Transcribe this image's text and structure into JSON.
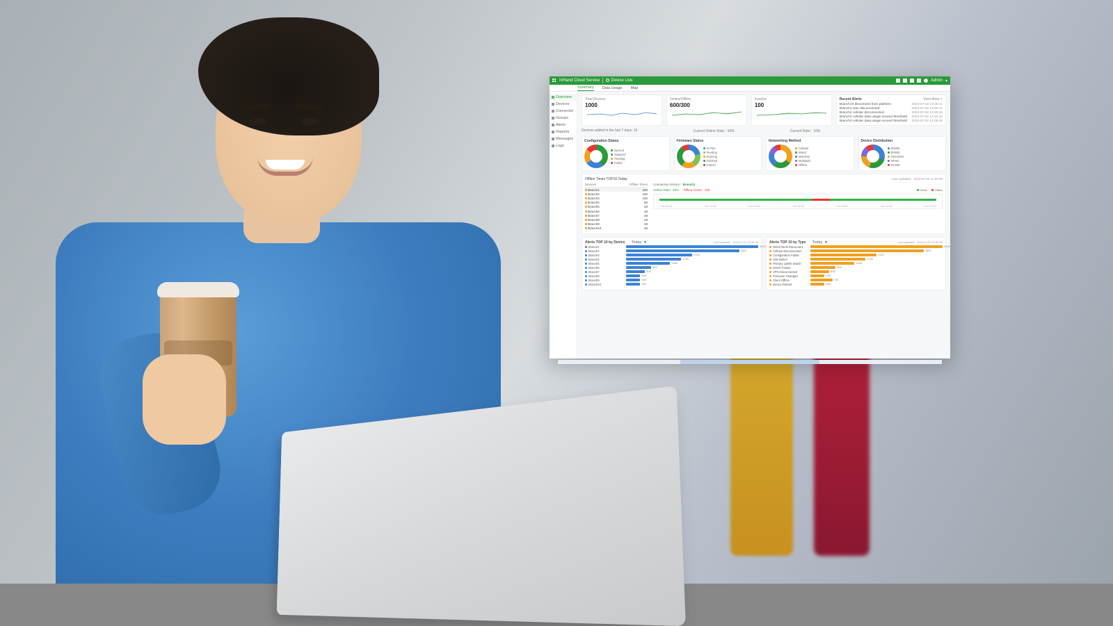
{
  "topbar": {
    "brand": "InHand Cloud Service",
    "section": "Device Live",
    "user": "Admin"
  },
  "tabs": [
    "Summary",
    "Data Usage",
    "Map"
  ],
  "sidebar": [
    {
      "label": "Overview",
      "active": true
    },
    {
      "label": "Devices"
    },
    {
      "label": "Connector"
    },
    {
      "label": "Groups"
    },
    {
      "label": "Alerts"
    },
    {
      "label": "Reports"
    },
    {
      "label": "Messages"
    },
    {
      "label": "Logs"
    }
  ],
  "kpi": [
    {
      "label": "Total Devices",
      "value": "1000"
    },
    {
      "label": "Online/Offline",
      "value": "600/300"
    },
    {
      "label": "Inactive",
      "value": "100"
    }
  ],
  "kpiAlerts": {
    "title": "Recent Alerts",
    "more": "View More >",
    "rows": [
      {
        "t": "Branch10 disconnect from platform",
        "d": "2023-07-02 13:45:11"
      },
      {
        "t": "Branch1 wan disconnected",
        "d": "2023-07-02 13:40:14"
      },
      {
        "t": "Branch2 cellular disconnected",
        "d": "2023-07-02 13:25:40"
      },
      {
        "t": "Branch2 cellular data usage exceed threshold",
        "d": "2023-07-02 12:10:22"
      },
      {
        "t": "Branch3 cellular data usage exceed threshold",
        "d": "2023-07-02 12:00:00"
      }
    ]
  },
  "below": {
    "a": "Devices added in the last 7 days: 10",
    "b": "Current Online Rate：60%",
    "c": "Current Rate：10%"
  },
  "donuts": [
    {
      "title": "Configuration Status",
      "legend": [
        [
          "Synced",
          "#2a9a3a"
        ],
        [
          "Suspend",
          "#3b82d6"
        ],
        [
          "Pending",
          "#f0a020"
        ],
        [
          "Failed",
          "#e33"
        ]
      ]
    },
    {
      "title": "Firmware Status",
      "legend": [
        [
          "In Plan",
          "#3b82d6"
        ],
        [
          "Pending",
          "#7cc250"
        ],
        [
          "Running",
          "#f0a020"
        ],
        [
          "Finished",
          "#2a9a3a"
        ],
        [
          "Cancel",
          "#e33"
        ]
      ]
    },
    {
      "title": "Networking Method",
      "legend": [
        [
          "Cellular",
          "#f0a020"
        ],
        [
          "Wired",
          "#2a9a3a"
        ],
        [
          "Wireless",
          "#3b82d6"
        ],
        [
          "Multipath",
          "#8a63d2"
        ],
        [
          "Offline",
          "#e33"
        ]
      ]
    },
    {
      "title": "Device Distribution",
      "legend": [
        [
          "ER805",
          "#3b82d6"
        ],
        [
          "ER605",
          "#2a9a3a"
        ],
        [
          "ODU2002",
          "#f0a020"
        ],
        [
          "InPAD",
          "#8a63d2"
        ],
        [
          "EC628",
          "#e33"
        ]
      ]
    }
  ],
  "offline": {
    "title": "Offline Times TOP10  Today",
    "updated": "Last Updated：2023-07-02 11:00:00",
    "cols": [
      "Devices",
      "Offline Times"
    ],
    "rows": [
      [
        "Branch1",
        "260"
      ],
      [
        "Branch2",
        "150"
      ],
      [
        "Branch3",
        "100"
      ],
      [
        "Branch4",
        "50"
      ],
      [
        "Branch5",
        "28"
      ],
      [
        "Branch6",
        "28"
      ],
      [
        "Branch7",
        "28"
      ],
      [
        "Branch8",
        "28"
      ],
      [
        "Branch9",
        "28"
      ],
      [
        "Branch10",
        "28"
      ]
    ],
    "history": {
      "title": "Connection History：",
      "dev": "Branch1",
      "online": "Online Rate：60%",
      "offline": "Offline Times：200",
      "ticks": [
        "7-02 00:00",
        "7-02 02:00",
        "7-02 04:00",
        "7-02 06:00",
        "7-02 08:00",
        "7-02 10:00",
        "7-02 12:00"
      ],
      "legend": [
        "Online",
        "Offline"
      ]
    }
  },
  "alertsDev": {
    "title": "Alerts TOP 10 by Device",
    "period": "Today",
    "updated": "Last Updated：2023-07-02 11:00:00",
    "color": "#3b82d6",
    "rows": [
      [
        "Branch1",
        4200
      ],
      [
        "Branch2",
        3600
      ],
      [
        "Branch3",
        2100
      ],
      [
        "Branch4",
        1750
      ],
      [
        "Branch5",
        1400
      ],
      [
        "Branch6",
        800
      ],
      [
        "Branch7",
        600
      ],
      [
        "Branch8",
        450
      ],
      [
        "Branch9",
        450
      ],
      [
        "Branch10",
        450
      ]
    ]
  },
  "alertsType": {
    "title": "Alerts TOP 10 by Type",
    "period": "Today",
    "updated": "Last Updated：2023-07-02 11:00:00",
    "color": "#f0a020",
    "rows": [
      [
        "Wired WAN Disconnect",
        4200
      ],
      [
        "Cellular Disconnected",
        3600
      ],
      [
        "Configuration Failed",
        2100
      ],
      [
        "SIM Switch",
        1750
      ],
      [
        "Primary Uplink Switch",
        1400
      ],
      [
        "DHCP Failure",
        800
      ],
      [
        "VPN Disconnected",
        600
      ],
      [
        "Firmware Changed",
        450
      ],
      [
        "Client Offline",
        700
      ],
      [
        "Device Reboot",
        450
      ]
    ]
  },
  "chart_data": [
    {
      "type": "bar",
      "title": "Alerts TOP 10 by Device",
      "categories": [
        "Branch1",
        "Branch2",
        "Branch3",
        "Branch4",
        "Branch5",
        "Branch6",
        "Branch7",
        "Branch8",
        "Branch9",
        "Branch10"
      ],
      "values": [
        4200,
        3600,
        2100,
        1750,
        1400,
        800,
        600,
        450,
        450,
        450
      ]
    },
    {
      "type": "bar",
      "title": "Alerts TOP 10 by Type",
      "categories": [
        "Wired WAN Disconnect",
        "Cellular Disconnected",
        "Configuration Failed",
        "SIM Switch",
        "Primary Uplink Switch",
        "DHCP Failure",
        "VPN Disconnected",
        "Firmware Changed",
        "Client Offline",
        "Device Reboot"
      ],
      "values": [
        4200,
        3600,
        2100,
        1750,
        1400,
        800,
        600,
        450,
        700,
        450
      ]
    },
    {
      "type": "table",
      "title": "Offline Times TOP10",
      "columns": [
        "Devices",
        "Offline Times"
      ],
      "rows": [
        [
          "Branch1",
          260
        ],
        [
          "Branch2",
          150
        ],
        [
          "Branch3",
          100
        ],
        [
          "Branch4",
          50
        ],
        [
          "Branch5",
          28
        ],
        [
          "Branch6",
          28
        ],
        [
          "Branch7",
          28
        ],
        [
          "Branch8",
          28
        ],
        [
          "Branch9",
          28
        ],
        [
          "Branch10",
          28
        ]
      ]
    }
  ]
}
